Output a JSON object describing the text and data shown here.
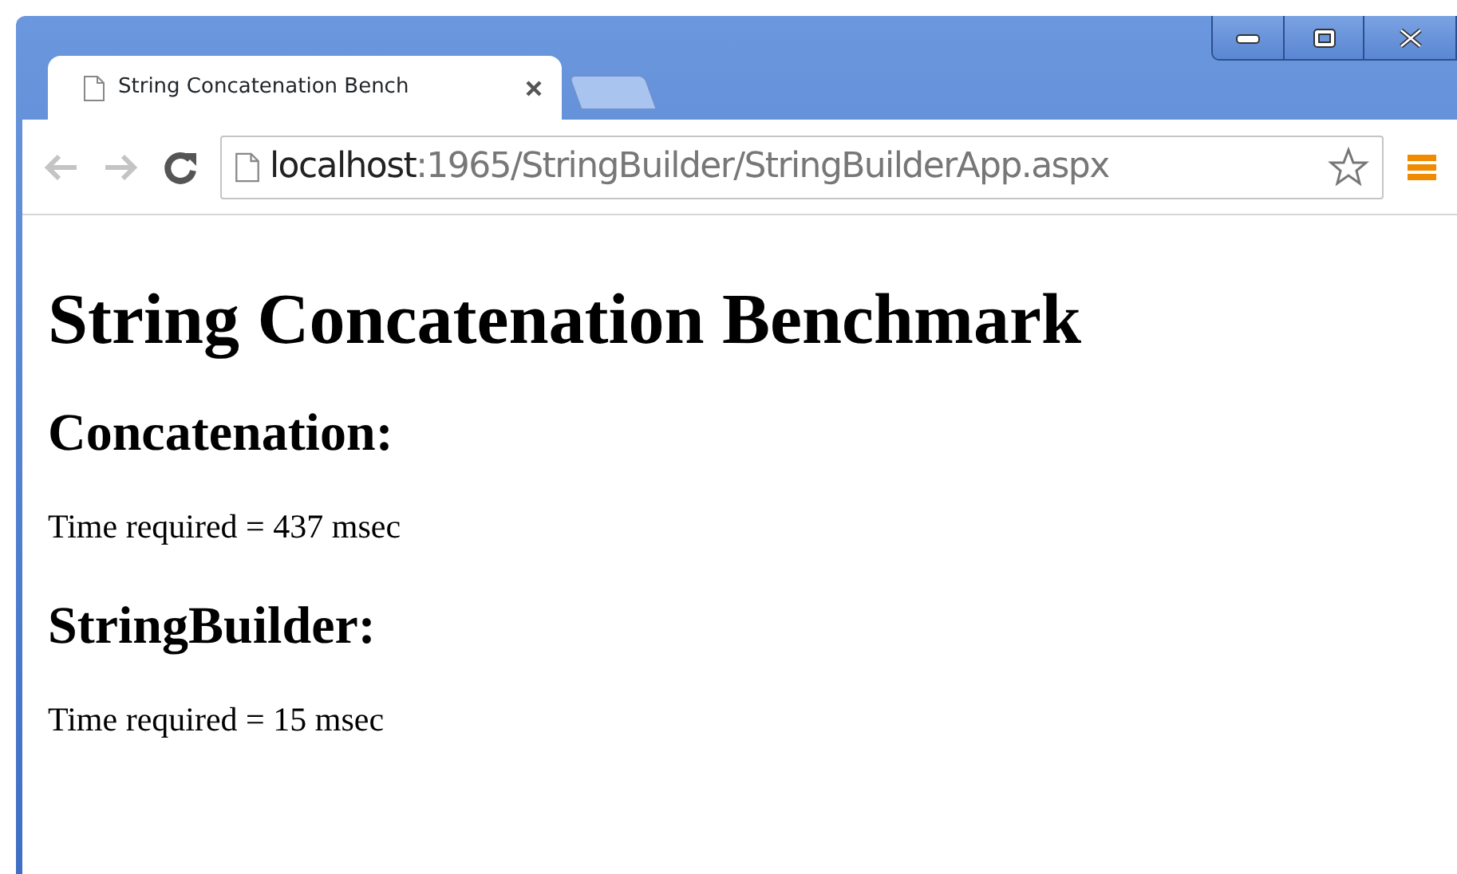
{
  "tabs": [
    {
      "title": "String Concatenation Bench",
      "selected": true
    }
  ],
  "toolbar": {
    "buttons": [
      {
        "kind": "back",
        "disabled": true
      },
      {
        "kind": "forward",
        "disabled": true
      },
      {
        "kind": "reload",
        "disabled": false
      }
    ],
    "address": {
      "host": "localhost",
      "path": ":1965/StringBuilder/StringBuilderApp.aspx"
    }
  },
  "page": {
    "heading": "String Concatenation Benchmark",
    "sections": [
      {
        "title": "Concatenation:",
        "result": "Time required = 437 msec"
      },
      {
        "title": "StringBuilder:",
        "result": "Time required = 15 msec"
      }
    ]
  }
}
